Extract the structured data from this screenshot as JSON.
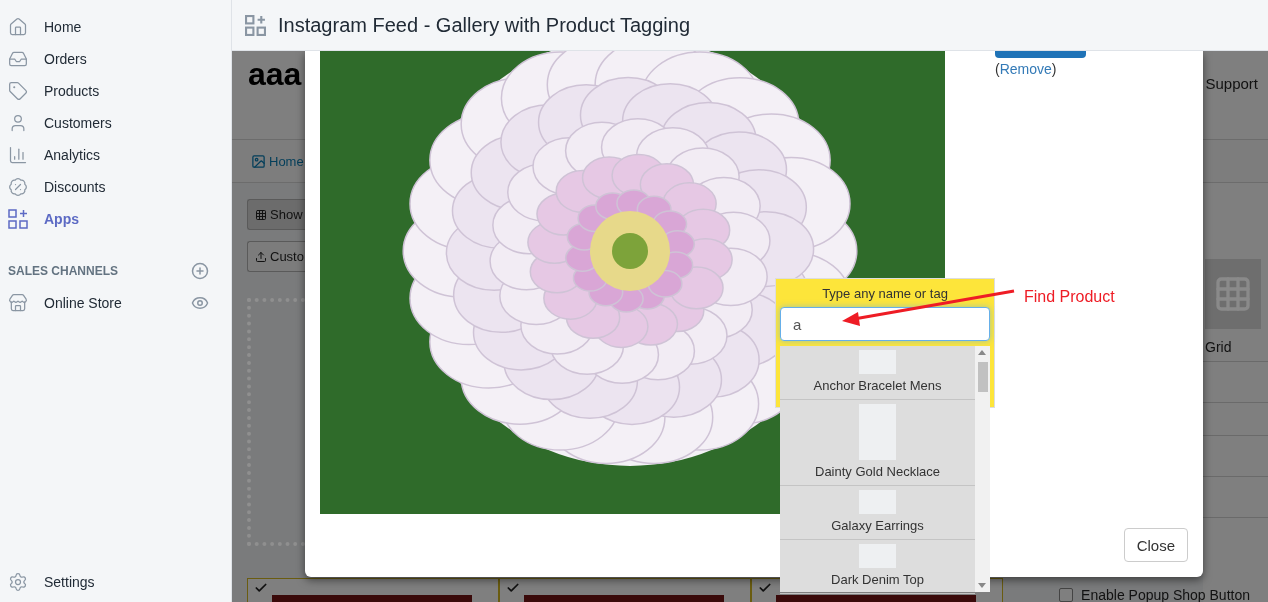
{
  "sidebar": {
    "items": [
      {
        "label": "Home",
        "selected": false
      },
      {
        "label": "Orders",
        "selected": false
      },
      {
        "label": "Products",
        "selected": false
      },
      {
        "label": "Customers",
        "selected": false
      },
      {
        "label": "Analytics",
        "selected": false
      },
      {
        "label": "Discounts",
        "selected": false
      },
      {
        "label": "Apps",
        "selected": true
      }
    ],
    "section": {
      "title": "SALES CHANNELS",
      "items": [
        {
          "label": "Online Store"
        }
      ]
    },
    "settings": {
      "label": "Settings"
    }
  },
  "topbar": {
    "title": "Instagram Feed - Gallery with Product Tagging"
  },
  "background_page": {
    "title": "aaa",
    "support": "Support",
    "nav": [
      {
        "label": "Home"
      }
    ],
    "buttons": [
      {
        "label": "Show"
      },
      {
        "label": "Custo"
      }
    ],
    "layout_option": "Grid",
    "cards": [
      {
        "checked": true
      },
      {
        "checked": true
      },
      {
        "checked": true
      }
    ],
    "setting": {
      "label": "Enable Popup Shop Button",
      "checked": false
    }
  },
  "modal": {
    "remove": {
      "open": "(",
      "link": "Remove",
      "close": ")"
    },
    "close_button": "Close",
    "product_search": {
      "label": "Type any name or tag",
      "value": "a",
      "results": [
        {
          "name": "Anchor Bracelet Mens"
        },
        {
          "name": "Dainty Gold Necklace"
        },
        {
          "name": "Galaxy Earrings"
        },
        {
          "name": "Dark Denim Top"
        }
      ]
    }
  },
  "annotation": {
    "text": "Find Product"
  }
}
